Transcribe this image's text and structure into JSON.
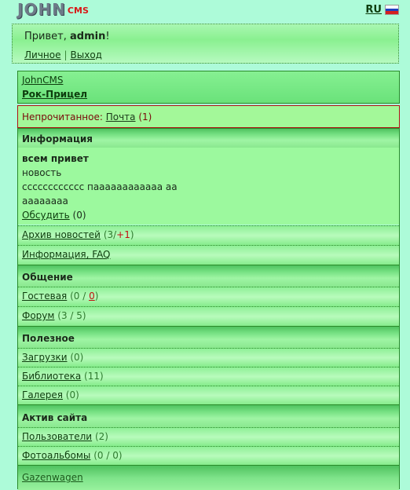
{
  "header": {
    "logo_main": "JOHN",
    "logo_sub": "CMS",
    "lang": "RU"
  },
  "greeting": {
    "prefix": "Привет, ",
    "user": "admin",
    "suffix": "!",
    "link_profile": "Личное",
    "link_exit": "Выход"
  },
  "userbox": {
    "link1": "JohnCMS",
    "link2": "Рок-Прицел"
  },
  "unread": {
    "label": "Непрочитанное: ",
    "link": "Почта",
    "count": "(1)"
  },
  "info": {
    "title": "Информация",
    "news_title": "всем привет",
    "news_line1": "новость",
    "news_line2": "сссссссссссс паааааааааааа аа",
    "news_line3": "аааааааа",
    "discuss": "Обсудить",
    "discuss_count": "(0)",
    "archive": "Архив новостей",
    "archive_count_a": "(3/",
    "archive_count_b": "+1",
    "archive_count_c": ")",
    "faq": "Информация, FAQ"
  },
  "communication": {
    "title": "Общение",
    "guest": "Гостевая",
    "guest_count_a": "(0 / ",
    "guest_count_b": "0",
    "guest_count_c": ")",
    "forum": "Форум",
    "forum_count": "(3 / 5)"
  },
  "useful": {
    "title": "Полезное",
    "downloads": "Загрузки",
    "downloads_count": "(0)",
    "library": "Библиотека",
    "library_count": "(11)",
    "gallery": "Галерея",
    "gallery_count": "(0)"
  },
  "activity": {
    "title": "Актив сайта",
    "users": "Пользователи",
    "users_count": "(2)",
    "albums": "Фотоальбомы",
    "albums_count": "(0 / 0)"
  },
  "footer_link": "Gazenwagen",
  "colors": {
    "bg": "#adfbd9",
    "link": "#0d3d0d",
    "accent_red": "#c01010",
    "border": "#2a8a2a"
  }
}
